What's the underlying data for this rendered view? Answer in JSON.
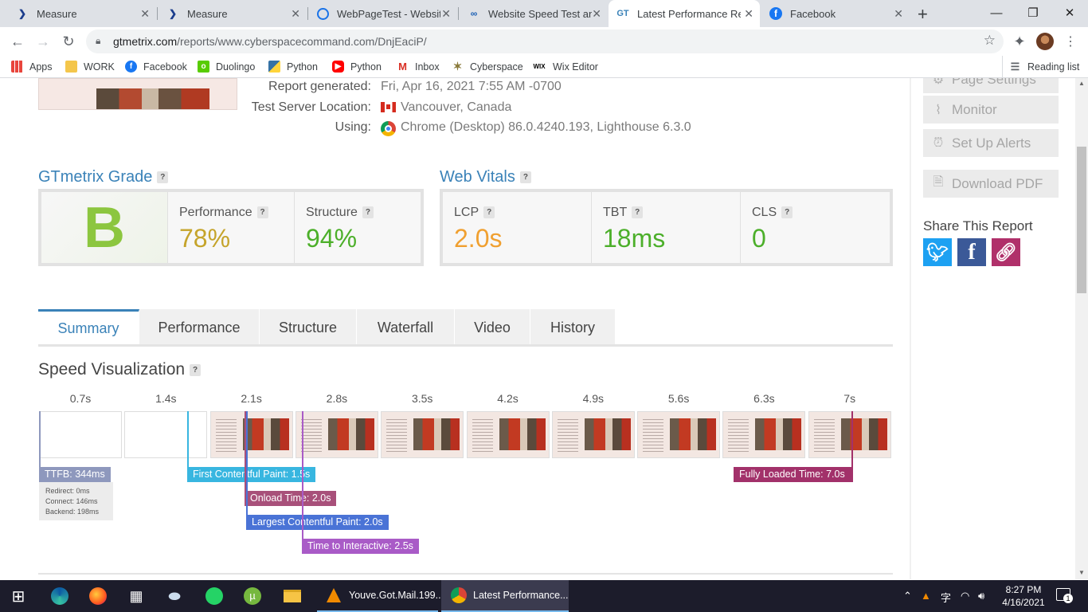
{
  "browser": {
    "tabs": [
      {
        "label": "Measure",
        "icon": "lighthouse-icon"
      },
      {
        "label": "Measure",
        "icon": "lighthouse-icon"
      },
      {
        "label": "WebPageTest - Website",
        "icon": "webpagetest-icon"
      },
      {
        "label": "Website Speed Test and",
        "icon": "pingdom-icon"
      },
      {
        "label": "Latest Performance Rep",
        "icon": "gtmetrix-icon"
      },
      {
        "label": "Facebook",
        "icon": "facebook-icon"
      }
    ],
    "new_tab": "+",
    "url_host": "gtmetrix.com",
    "url_path": "/reports/www.cyberspacecommand.com/DnjEaciP/",
    "bookmarks": [
      {
        "label": "Apps"
      },
      {
        "label": "WORK"
      },
      {
        "label": "Facebook"
      },
      {
        "label": "Duolingo"
      },
      {
        "label": "Python"
      },
      {
        "label": "Python"
      },
      {
        "label": "Inbox"
      },
      {
        "label": "Cyberspace"
      },
      {
        "label": "Wix Editor"
      }
    ],
    "reading_list": "Reading list"
  },
  "report": {
    "generated_label": "Report generated:",
    "generated_value": "Fri, Apr 16, 2021 7:55 AM -0700",
    "server_label": "Test Server Location:",
    "server_value": "Vancouver, Canada",
    "using_label": "Using:",
    "using_value": "Chrome (Desktop) 86.0.4240.193, Lighthouse 6.3.0"
  },
  "grade": {
    "title": "GTmetrix Grade",
    "letter": "B",
    "performance_label": "Performance",
    "performance_value": "78%",
    "structure_label": "Structure",
    "structure_value": "94%"
  },
  "vitals": {
    "title": "Web Vitals",
    "lcp_label": "LCP",
    "lcp_value": "2.0s",
    "tbt_label": "TBT",
    "tbt_value": "18ms",
    "cls_label": "CLS",
    "cls_value": "0"
  },
  "report_tabs": [
    "Summary",
    "Performance",
    "Structure",
    "Waterfall",
    "Video",
    "History"
  ],
  "speed": {
    "title": "Speed Visualization",
    "ticks": [
      "0.7s",
      "1.4s",
      "2.1s",
      "2.8s",
      "3.5s",
      "4.2s",
      "4.9s",
      "5.6s",
      "6.3s",
      "7s"
    ],
    "ttfb": "TTFB: 344ms",
    "ttfb_details": [
      "Redirect: 0ms",
      "Connect: 146ms",
      "Backend: 198ms"
    ],
    "fcp": "First Contentful Paint: 1.5s",
    "onload": "Onload Time: 2.0s",
    "lcp": "Largest Contentful Paint: 2.0s",
    "tti": "Time to Interactive: 2.5s",
    "fully_loaded": "Fully Loaded Time: 7.0s"
  },
  "sidebar": {
    "page_settings": "Page Settings",
    "monitor": "Monitor",
    "alerts": "Set Up Alerts",
    "pdf": "Download PDF",
    "share_title": "Share This Report"
  },
  "taskbar": {
    "apps": [
      {
        "label": "Youve.Got.Mail.199..."
      },
      {
        "label": "Latest Performance..."
      }
    ],
    "time": "8:27 PM",
    "date": "4/16/2021",
    "notif_count": "1"
  },
  "colors": {
    "gtmetrix_blue": "#3a82b8",
    "grade_green": "#8cc63f",
    "perf_yellow": "#c5a42b",
    "good_green": "#4caf2a",
    "lcp_orange": "#f0a030",
    "ttfb": "#8e98bd",
    "fcp": "#38b6e0",
    "onload": "#a8507a",
    "lcp_line": "#4a73d6",
    "tti": "#a95bc7",
    "fully_loaded": "#a2316a"
  }
}
